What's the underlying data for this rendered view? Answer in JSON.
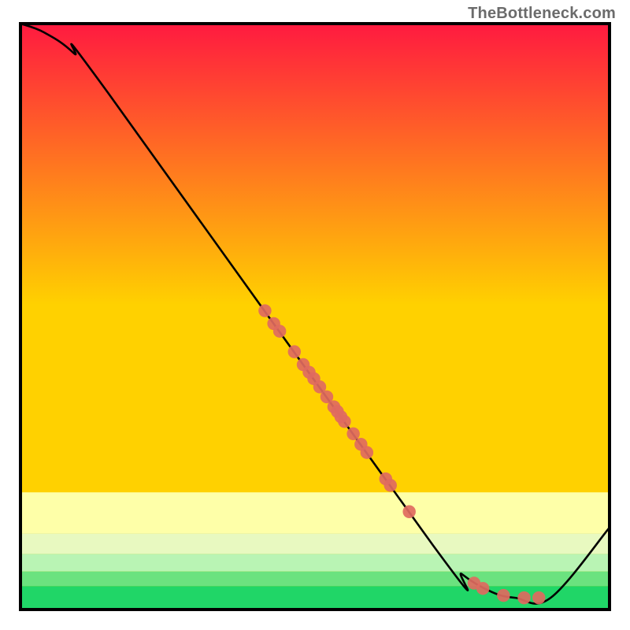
{
  "watermark": "TheBottleneck.com",
  "colors": {
    "frame": "#000000",
    "curve": "#000000",
    "dot_fill": "#e06a5f",
    "top_grad": "#ff1a40",
    "mid_grad": "#ffd100",
    "band_yellow_soft": "#feffa8",
    "band_green_light": "#b9f4b4",
    "band_green_mid": "#6be27f",
    "band_green_deep": "#20d667"
  },
  "chart_data": {
    "type": "line",
    "title": "",
    "xlabel": "",
    "ylabel": "",
    "xlim": [
      0,
      100
    ],
    "ylim": [
      0,
      100
    ],
    "grid": false,
    "legend": false,
    "curve": [
      {
        "x": 0,
        "y": 100
      },
      {
        "x": 4,
        "y": 98.5
      },
      {
        "x": 9,
        "y": 95
      },
      {
        "x": 15,
        "y": 88
      },
      {
        "x": 70,
        "y": 11
      },
      {
        "x": 75,
        "y": 6
      },
      {
        "x": 80,
        "y": 3
      },
      {
        "x": 84,
        "y": 2
      },
      {
        "x": 90,
        "y": 2
      },
      {
        "x": 100,
        "y": 14
      }
    ],
    "dots": [
      {
        "x": 41.5,
        "y": 51.0
      },
      {
        "x": 43.0,
        "y": 48.8
      },
      {
        "x": 44.0,
        "y": 47.5
      },
      {
        "x": 46.5,
        "y": 44.0
      },
      {
        "x": 48.0,
        "y": 41.8
      },
      {
        "x": 49.0,
        "y": 40.5
      },
      {
        "x": 49.8,
        "y": 39.4
      },
      {
        "x": 50.8,
        "y": 38.0
      },
      {
        "x": 52.0,
        "y": 36.3
      },
      {
        "x": 53.2,
        "y": 34.6
      },
      {
        "x": 53.8,
        "y": 33.8
      },
      {
        "x": 54.4,
        "y": 32.9
      },
      {
        "x": 55.0,
        "y": 32.1
      },
      {
        "x": 56.5,
        "y": 30.0
      },
      {
        "x": 57.8,
        "y": 28.2
      },
      {
        "x": 58.8,
        "y": 26.8
      },
      {
        "x": 62.0,
        "y": 22.3
      },
      {
        "x": 62.8,
        "y": 21.2
      },
      {
        "x": 66.0,
        "y": 16.7
      },
      {
        "x": 77.0,
        "y": 4.5
      },
      {
        "x": 78.5,
        "y": 3.6
      },
      {
        "x": 82.0,
        "y": 2.4
      },
      {
        "x": 85.5,
        "y": 2.0
      },
      {
        "x": 88.0,
        "y": 2.0
      }
    ],
    "dot_radius": 1.1
  }
}
